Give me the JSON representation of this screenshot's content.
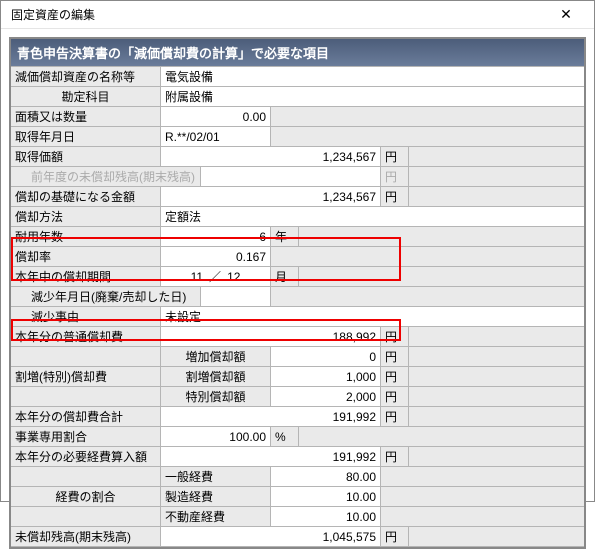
{
  "window": {
    "title": "固定資産の編集"
  },
  "panel": {
    "header": "青色申告決算書の「減価償却費の計算」で必要な項目"
  },
  "rows": {
    "asset_name": {
      "label": "減価償却資産の名称等",
      "value": "電気設備"
    },
    "account": {
      "label": "勘定科目",
      "value": "附属設備"
    },
    "area_qty": {
      "label": "面積又は数量",
      "value": "0.00"
    },
    "acq_date": {
      "label": "取得年月日",
      "value": "R.**/02/01"
    },
    "acq_price": {
      "label": "取得価額",
      "value": "1,234,567",
      "unit": "円"
    },
    "prev_balance": {
      "label": "前年度の未償却残高(期末残高)",
      "value": "",
      "unit": "円"
    },
    "basis": {
      "label": "償却の基礎になる金額",
      "value": "1,234,567",
      "unit": "円"
    },
    "method": {
      "label": "償却方法",
      "value": "定額法"
    },
    "life": {
      "label": "耐用年数",
      "value": "6",
      "unit": "年"
    },
    "rate": {
      "label": "償却率",
      "value": "0.167"
    },
    "period": {
      "label": "本年中の償却期間",
      "m1": "11",
      "sep": "／",
      "m2": "12",
      "unit": "月"
    },
    "decrease_date": {
      "label": "減少年月日(廃棄/売却した日)",
      "value": ""
    },
    "decrease_reason": {
      "label": "減少事由",
      "value": "未設定"
    },
    "ordinary_dep": {
      "label": "本年分の普通償却費",
      "value": "188,992",
      "unit": "円"
    },
    "special_group": "割増(特別)償却費",
    "inc_dep": {
      "label": "増加償却額",
      "value": "0",
      "unit": "円"
    },
    "extra_dep": {
      "label": "割増償却額",
      "value": "1,000",
      "unit": "円"
    },
    "special_dep": {
      "label": "特別償却額",
      "value": "2,000",
      "unit": "円"
    },
    "total_dep": {
      "label": "本年分の償却費合計",
      "value": "191,992",
      "unit": "円"
    },
    "biz_ratio": {
      "label": "事業専用割合",
      "value": "100.00",
      "unit": "%"
    },
    "necessary_exp": {
      "label": "本年分の必要経費算入額",
      "value": "191,992",
      "unit": "円"
    },
    "exp_ratio_group": "経費の割合",
    "exp_general": {
      "label": "一般経費",
      "value": "80.00"
    },
    "exp_mfg": {
      "label": "製造経費",
      "value": "10.00"
    },
    "exp_realestate": {
      "label": "不動産経費",
      "value": "10.00"
    },
    "end_balance": {
      "label": "未償却残高(期末残高)",
      "value": "1,045,575",
      "unit": "円"
    }
  }
}
